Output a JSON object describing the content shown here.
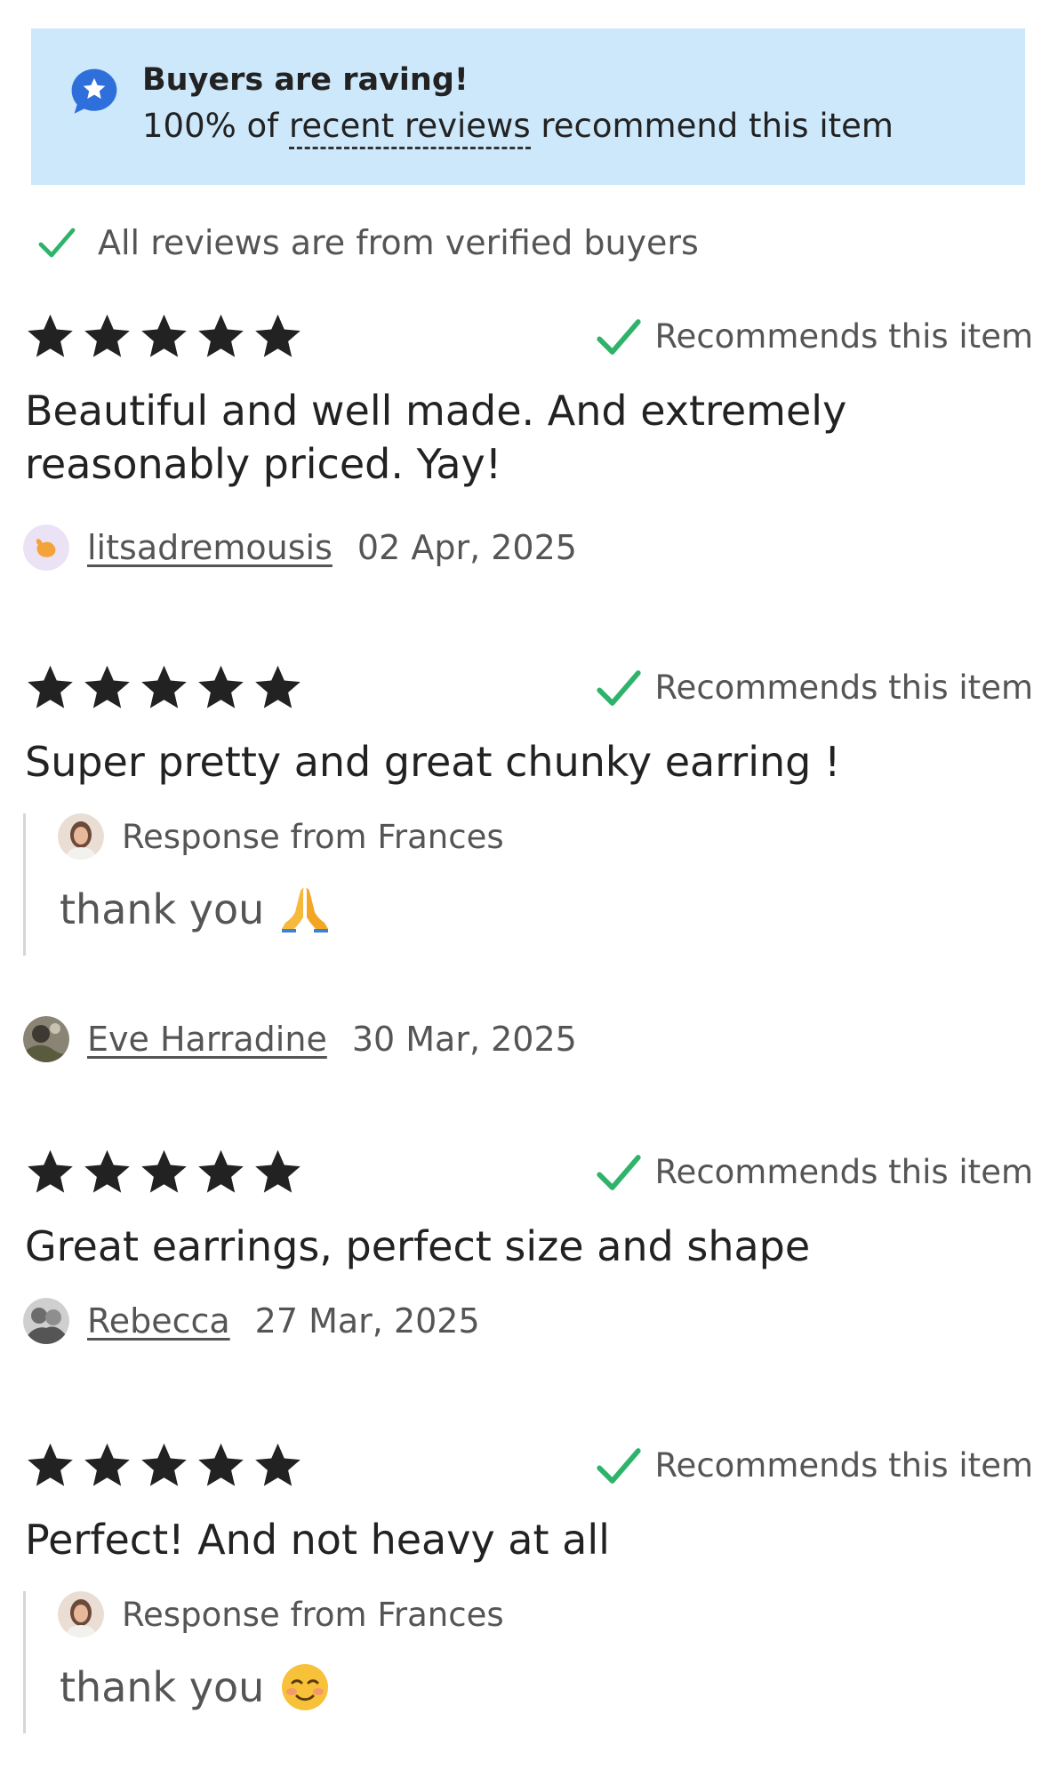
{
  "banner": {
    "icon": "star-chat-icon",
    "title": "Buyers are raving!",
    "text_pre": "100% of ",
    "link_text": "recent reviews",
    "text_post": " recommend this item",
    "bg_color": "#cde8fb",
    "icon_color": "#2f6fdb"
  },
  "verified": {
    "icon": "check-icon",
    "text": "All reviews are from verified buyers",
    "check_color": "#2fb36a"
  },
  "recommend_label": "Recommends this item",
  "reviews": [
    {
      "rating": 5,
      "text": "Beautiful and well made. And extremely reasonably priced. Yay!",
      "reviewer": "litsadremousis",
      "date": "02 Apr, 2025"
    },
    {
      "rating": 5,
      "text": "Super pretty and great chunky earring !",
      "response_label": "Response from Frances",
      "response_text": "thank you",
      "response_emoji": "folded-hands-emoji",
      "reviewer": "Eve Harradine",
      "date": "30 Mar, 2025"
    },
    {
      "rating": 5,
      "text": "Great earrings, perfect size and shape",
      "reviewer": "Rebecca",
      "date": "27 Mar, 2025"
    },
    {
      "rating": 5,
      "text": "Perfect! And not heavy at all",
      "response_label": "Response from Frances",
      "response_text": "thank you",
      "response_emoji": "smiling-face-emoji"
    }
  ]
}
